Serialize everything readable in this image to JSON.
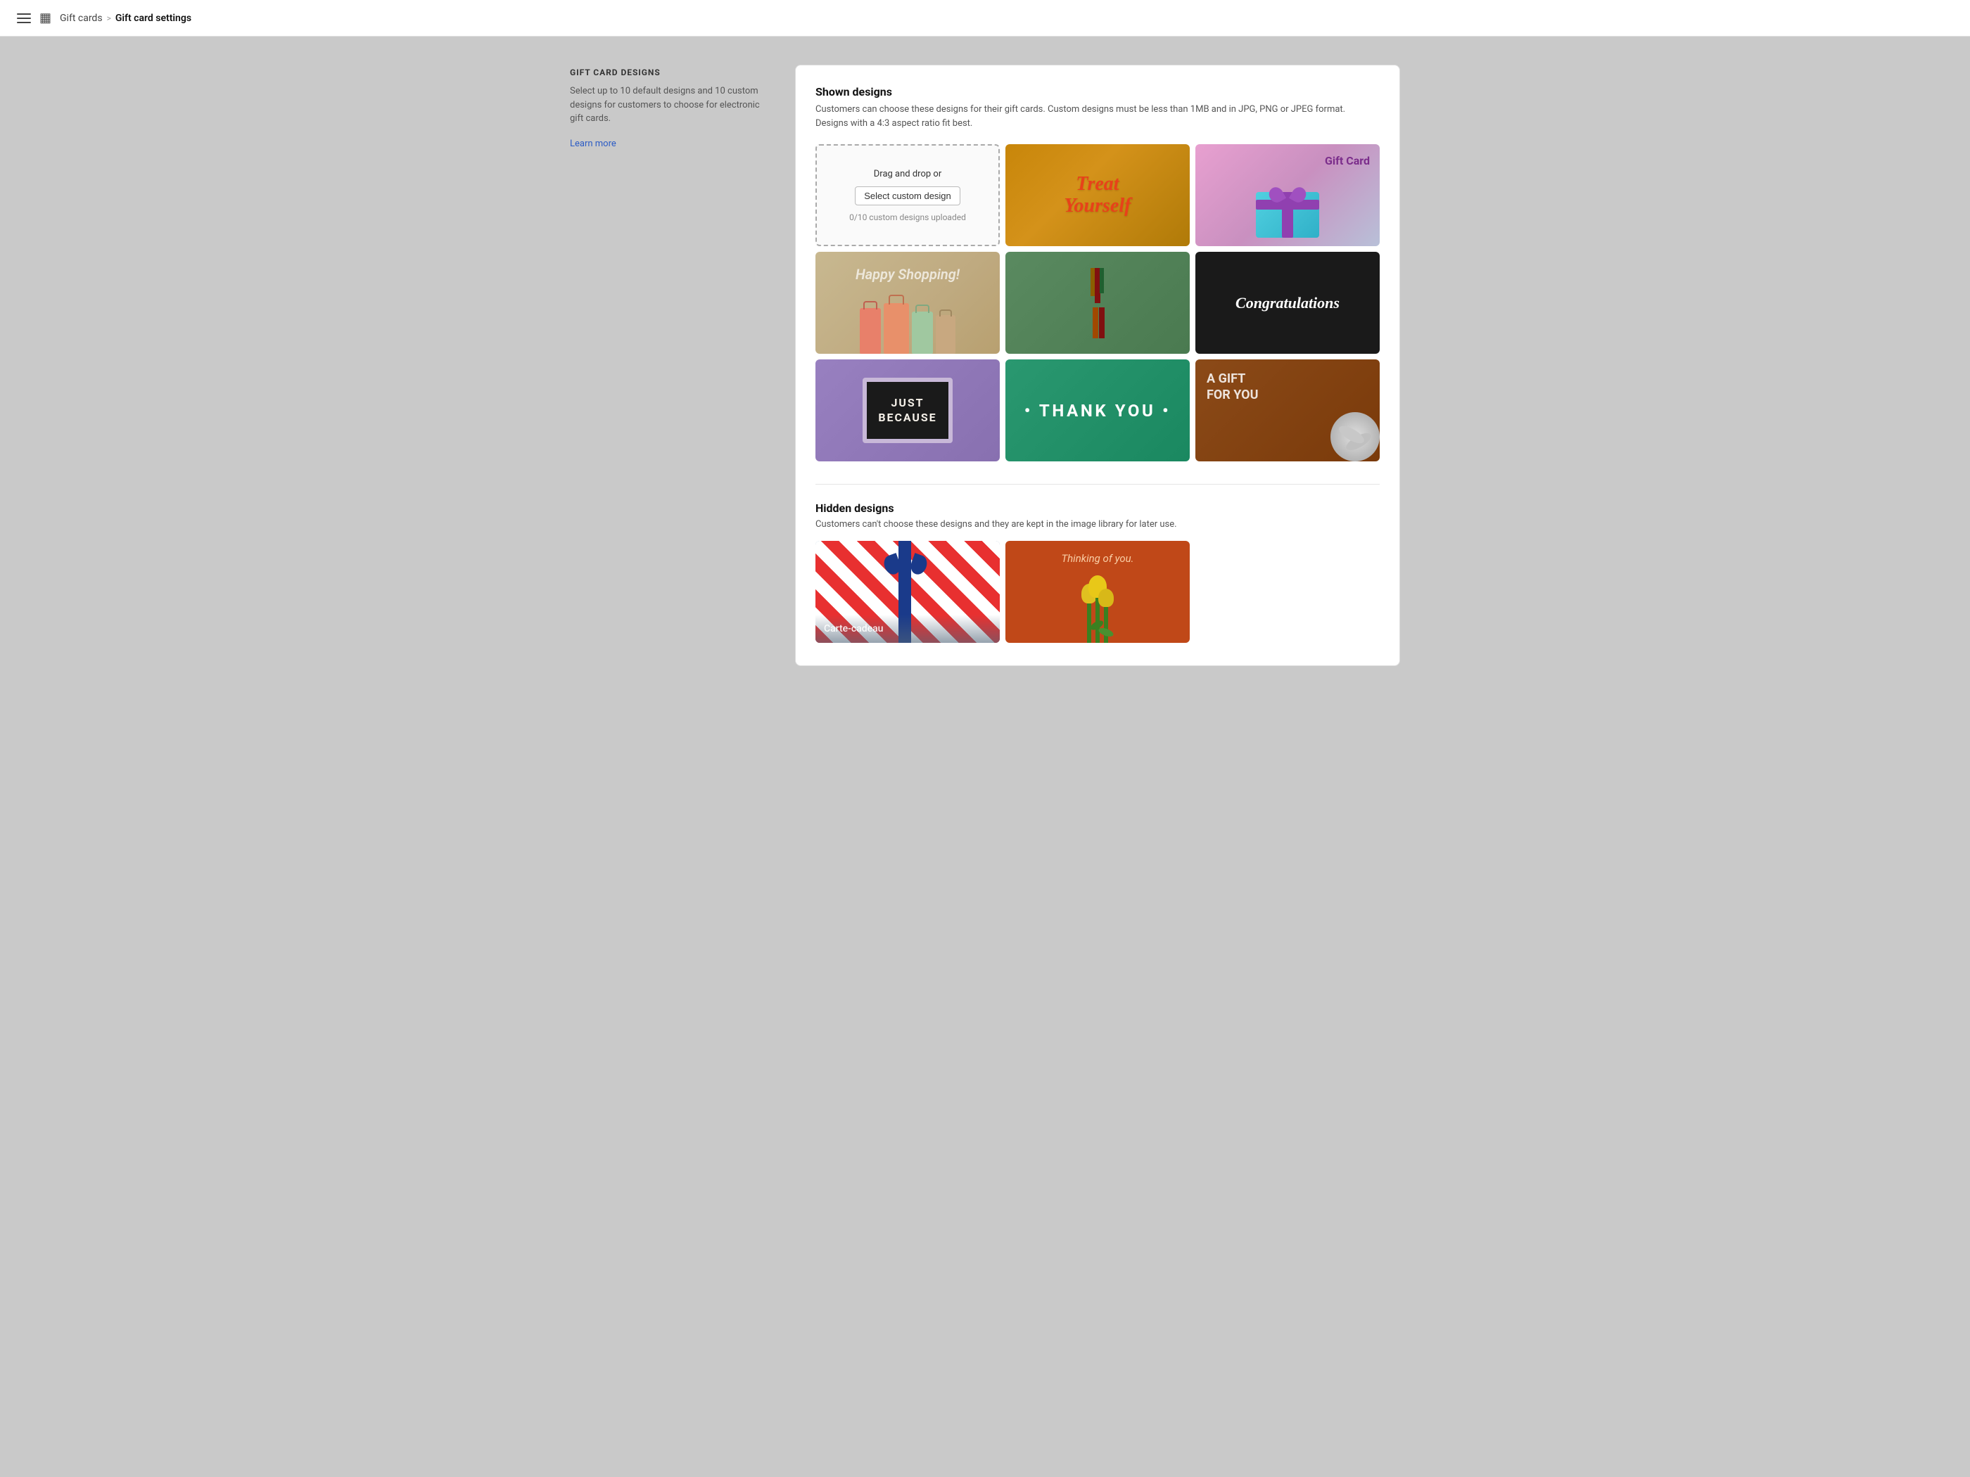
{
  "topbar": {
    "menu_icon_label": "Menu",
    "gift_icon_label": "Gift cards",
    "breadcrumb_parent": "Gift cards",
    "breadcrumb_separator": ">",
    "breadcrumb_current": "Gift card settings"
  },
  "sidebar": {
    "section_title": "GIFT CARD DESIGNS",
    "description": "Select up to 10 default designs and 10 custom designs for customers to choose for electronic gift cards.",
    "learn_more_label": "Learn more"
  },
  "shown_section": {
    "title": "Shown designs",
    "description": "Customers can choose these designs for their gift cards. Custom designs must be less than 1MB and in JPG, PNG or JPEG format. Designs with a 4:3 aspect ratio fit best."
  },
  "upload_card": {
    "drag_drop_text": "Drag and drop or",
    "button_label": "Select custom design",
    "count_text": "0/10 custom designs uploaded"
  },
  "designs": [
    {
      "id": "treat-yourself",
      "type": "treat",
      "alt": "Treat Yourself design"
    },
    {
      "id": "gift-card",
      "type": "giftcard",
      "alt": "Gift Card with bow design"
    },
    {
      "id": "happy-shopping",
      "type": "shopping",
      "alt": "Happy Shopping design"
    },
    {
      "id": "presents",
      "type": "presents",
      "alt": "Colorful presents design"
    },
    {
      "id": "congratulations",
      "type": "congrats",
      "alt": "Congratulations design"
    },
    {
      "id": "just-because",
      "type": "justbecause",
      "alt": "Just Because letterboard design"
    },
    {
      "id": "thank-you",
      "type": "thankyou",
      "alt": "Thank You design"
    },
    {
      "id": "a-gift-for-you",
      "type": "agiftforyou",
      "alt": "A Gift For You design"
    }
  ],
  "treat_text_line1": "Treat",
  "treat_text_line2": "Yourself",
  "giftcard_label": "Gift Card",
  "shopping_text": "Happy Shopping!",
  "congrats_text": "Congratulations",
  "justbecause_line1": "JUST",
  "justbecause_line2": "BECAUSE",
  "thankyou_text": "• THANK YOU •",
  "agift_line1": "A GIFT",
  "agift_line2": "FOR YOU",
  "hidden_section": {
    "title": "Hidden designs",
    "description": "Customers can't choose these designs and they are kept in the image library for later use."
  },
  "hidden_designs": [
    {
      "id": "carte-cadeau",
      "type": "cartecadeau",
      "alt": "Carte-cadeau design"
    },
    {
      "id": "thinking-of-you",
      "type": "thinking",
      "alt": "Thinking of you design"
    }
  ],
  "cartecadeau_text": "Carte-cadeau",
  "thinking_text": "Thinking of you."
}
